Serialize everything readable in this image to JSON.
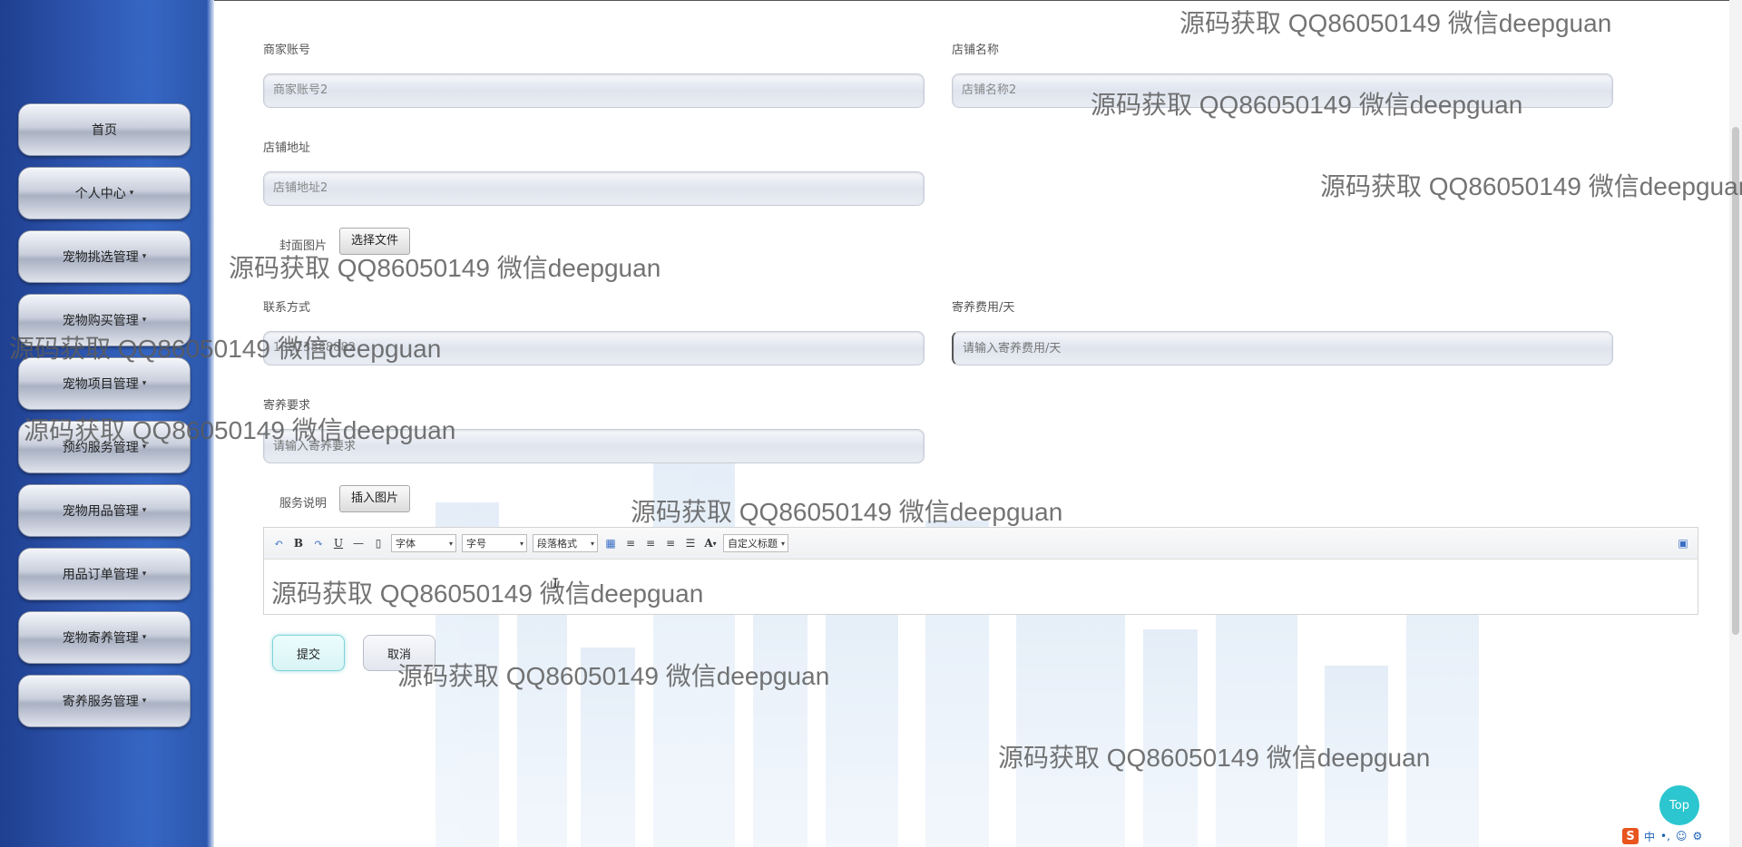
{
  "sidebar": {
    "items": [
      {
        "label": "首页",
        "has_caret": false
      },
      {
        "label": "个人中心",
        "has_caret": true
      },
      {
        "label": "宠物挑选管理",
        "has_caret": true
      },
      {
        "label": "宠物购买管理",
        "has_caret": true
      },
      {
        "label": "宠物项目管理",
        "has_caret": true
      },
      {
        "label": "预约服务管理",
        "has_caret": true
      },
      {
        "label": "宠物用品管理",
        "has_caret": true
      },
      {
        "label": "用品订单管理",
        "has_caret": true
      },
      {
        "label": "宠物寄养管理",
        "has_caret": true
      },
      {
        "label": "寄养服务管理",
        "has_caret": true
      }
    ],
    "caret": "▾"
  },
  "form": {
    "merchant_account_label": "商家账号",
    "merchant_account_value": "商家账号2",
    "shop_name_label": "店铺名称",
    "shop_name_value": "店铺名称2",
    "shop_address_label": "店铺地址",
    "shop_address_value": "店铺地址2",
    "cover_image_label": "封面图片",
    "choose_file_button": "选择文件",
    "contact_label": "联系方式",
    "contact_value": "13823888882",
    "fee_label": "寄养费用/天",
    "fee_placeholder": "请输入寄养费用/天",
    "requirement_label": "寄养要求",
    "requirement_placeholder": "请输入寄养要求",
    "service_desc_label": "服务说明",
    "insert_image_button": "插入图片"
  },
  "editor": {
    "font_family_select": "字体",
    "font_size_select": "字号",
    "paragraph_select": "段落格式",
    "custom_heading_select": "自定义标题",
    "toolbar_icons": [
      "undo-icon",
      "bold-icon",
      "redo-icon",
      "underline-icon",
      "horizontal-rule-icon",
      "paste-plain-icon",
      "table-icon",
      "align-left-icon",
      "align-center-icon",
      "align-right-icon",
      "justify-icon",
      "font-color-icon",
      "fullscreen-icon"
    ],
    "bold_glyph": "B",
    "underline_glyph": "U",
    "font_color_glyph": "A"
  },
  "actions": {
    "submit_label": "提交",
    "cancel_label": "取消",
    "top_label": "Top"
  },
  "ime": {
    "logo": "S",
    "mode": "中"
  },
  "watermark": "源码获取 QQ86050149 微信deepguan"
}
